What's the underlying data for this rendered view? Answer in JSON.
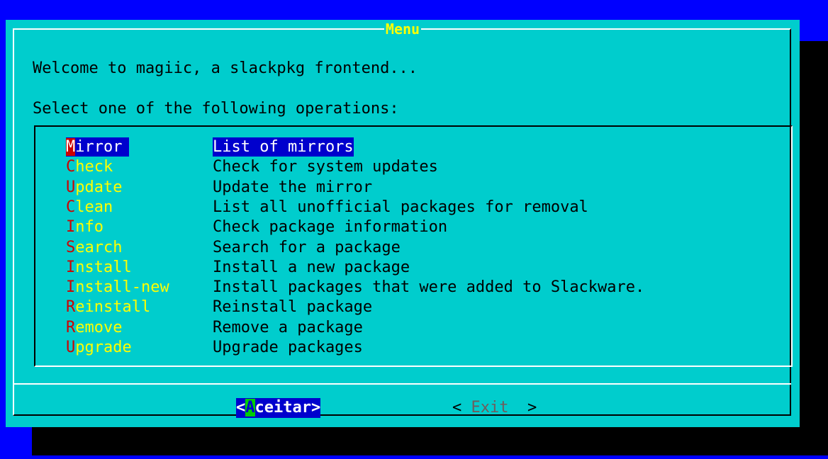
{
  "dialog": {
    "title": "Menu",
    "welcome": "Welcome to magiic, a slackpkg frontend...",
    "prompt": "Select one of the following operations:"
  },
  "menu": [
    {
      "tag_hot": "M",
      "tag_rest": "irror",
      "desc": "List of mirrors",
      "selected": true
    },
    {
      "tag_hot": "C",
      "tag_rest": "heck",
      "desc": "Check for system updates"
    },
    {
      "tag_hot": "U",
      "tag_rest": "pdate",
      "desc": "Update the mirror"
    },
    {
      "tag_hot": "C",
      "tag_rest": "lean",
      "desc": "List all unofficial packages for removal"
    },
    {
      "tag_hot": "I",
      "tag_rest": "nfo",
      "desc": "Check package information"
    },
    {
      "tag_hot": "S",
      "tag_rest": "earch",
      "desc": "Search for a package"
    },
    {
      "tag_hot": "I",
      "tag_rest": "nstall",
      "desc": "Install a new package"
    },
    {
      "tag_hot": "I",
      "tag_rest": "nstall-new",
      "desc": "Install packages that were added to Slackware."
    },
    {
      "tag_hot": "R",
      "tag_rest": "einstall",
      "desc": "Reinstall package"
    },
    {
      "tag_hot": "R",
      "tag_rest": "emove",
      "desc": "Remove a package"
    },
    {
      "tag_hot": "U",
      "tag_rest": "pgrade",
      "desc": "Upgrade packages"
    }
  ],
  "buttons": {
    "ok": {
      "open": "<",
      "hot": "A",
      "rest": "ceitar",
      "close": ">"
    },
    "exit": {
      "open": "< ",
      "label": "Exit",
      "close": "  >"
    }
  },
  "colors": {
    "screen_bg": "#0000ff",
    "dialog_bg": "#00cdcd",
    "title_color": "#ffff00",
    "selection_bg": "#0000cd",
    "hotkey_color": "#cd0000"
  }
}
